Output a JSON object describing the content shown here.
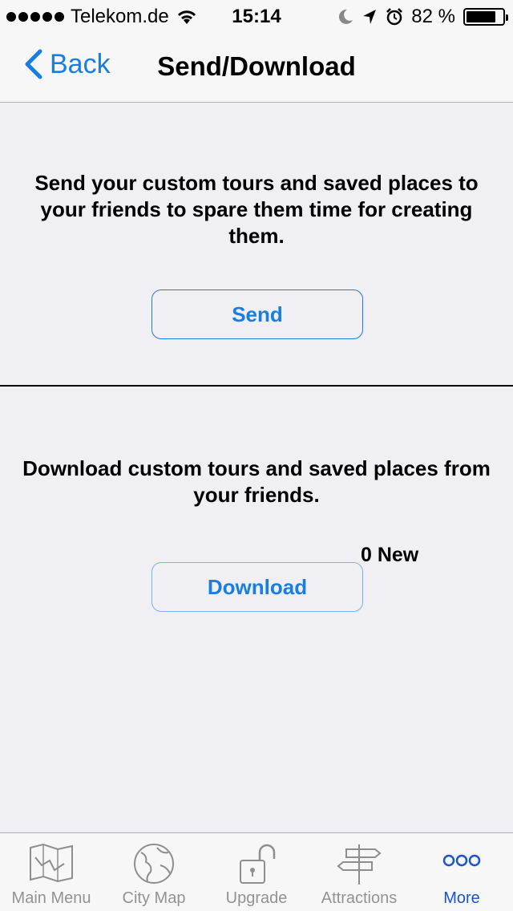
{
  "status_bar": {
    "carrier": "Telekom.de",
    "time": "15:14",
    "battery_percent": "82 %",
    "battery_level": 0.82
  },
  "nav": {
    "back_label": "Back",
    "title": "Send/Download"
  },
  "send_section": {
    "text": "Send your custom tours and saved places to your friends to spare them time for creating them.",
    "button_label": "Send"
  },
  "download_section": {
    "text": "Download custom tours and saved places from your friends.",
    "new_count": "0 New",
    "button_label": "Download"
  },
  "tabs": [
    {
      "label": "Main Menu",
      "icon": "map-icon"
    },
    {
      "label": "City Map",
      "icon": "globe-icon"
    },
    {
      "label": "Upgrade",
      "icon": "unlock-icon"
    },
    {
      "label": "Attractions",
      "icon": "signpost-icon"
    },
    {
      "label": "More",
      "icon": "more-icon",
      "active": true
    }
  ],
  "colors": {
    "accent": "#1a7ee0",
    "active_tab": "#1a55c8",
    "inactive_tab": "#929292",
    "background": "#efeff4"
  }
}
